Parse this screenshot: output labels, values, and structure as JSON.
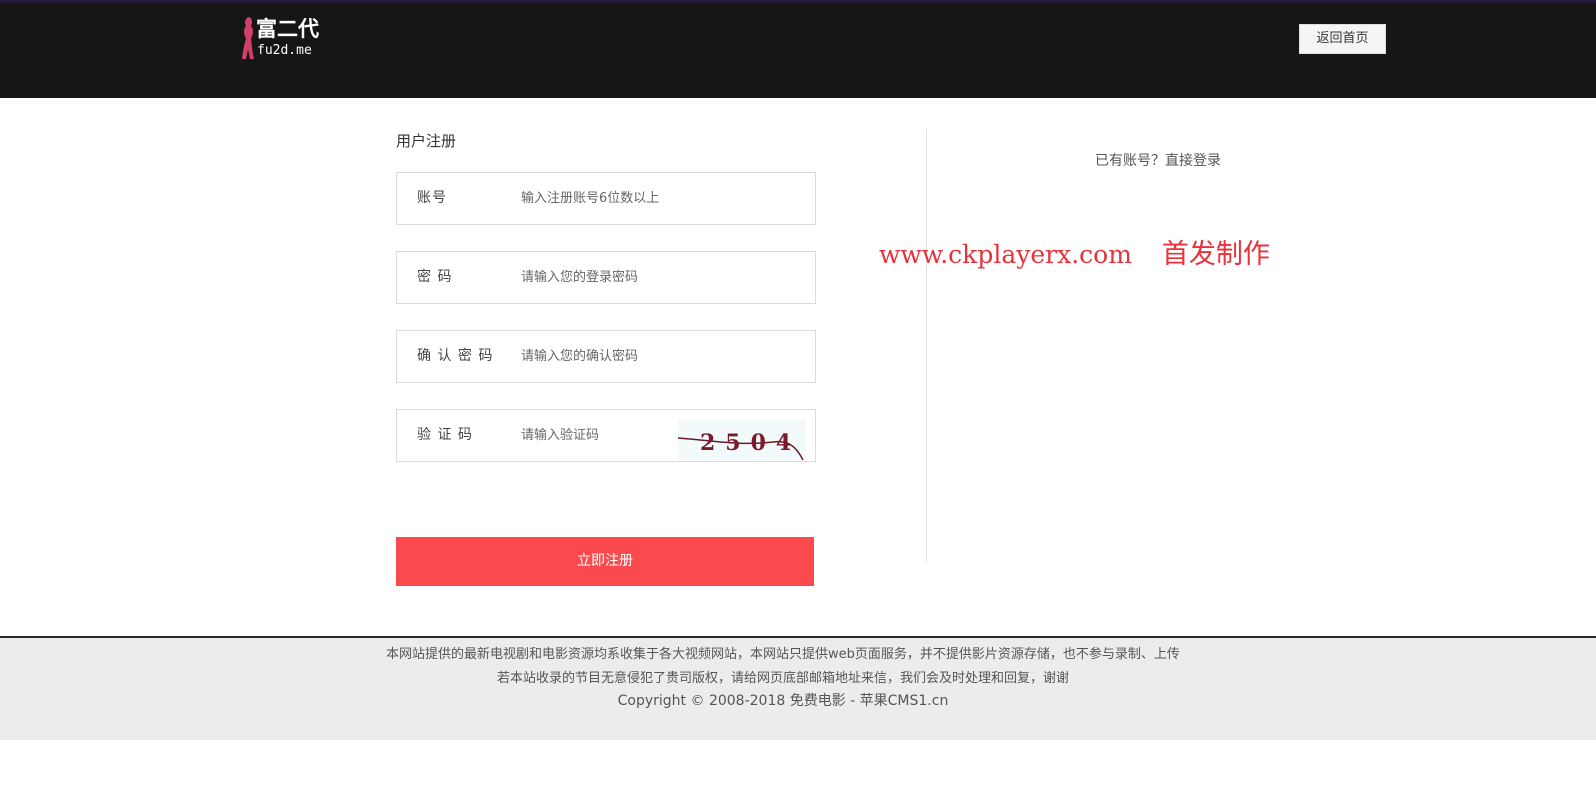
{
  "header": {
    "logo_cn": "富二代",
    "logo_en": "fu2d.me",
    "home_button": "返回首页"
  },
  "form": {
    "title": "用户注册",
    "fields": [
      {
        "label": "账号",
        "placeholder": "输入注册账号6位数以上"
      },
      {
        "label": "密 码",
        "placeholder": "请输入您的登录密码"
      },
      {
        "label": "确 认 密 码",
        "placeholder": "请输入您的确认密码"
      },
      {
        "label": "验 证 码",
        "placeholder": "请输入验证码"
      }
    ],
    "captcha_text": "2504",
    "submit": "立即注册"
  },
  "side": {
    "prompt": "已有账号？",
    "login_link": "直接登录"
  },
  "watermark": {
    "url": "www.ckplayerx.com",
    "text": "首发制作"
  },
  "footer": {
    "line1": "本网站提供的最新电视剧和电影资源均系收集于各大视频网站，本网站只提供web页面服务，并不提供影片资源存储，也不参与录制、上传",
    "line2": "若本站收录的节目无意侵犯了贵司版权，请给网页底部邮箱地址来信，我们会及时处理和回复，谢谢",
    "line3": "Copyright © 2008-2018 免费电影 - 苹果CMS1.cn"
  },
  "colors": {
    "header_bg": "#161616",
    "submit_bg": "#fb4a4d",
    "watermark": "#e8323a",
    "footer_bg": "#ececec"
  }
}
